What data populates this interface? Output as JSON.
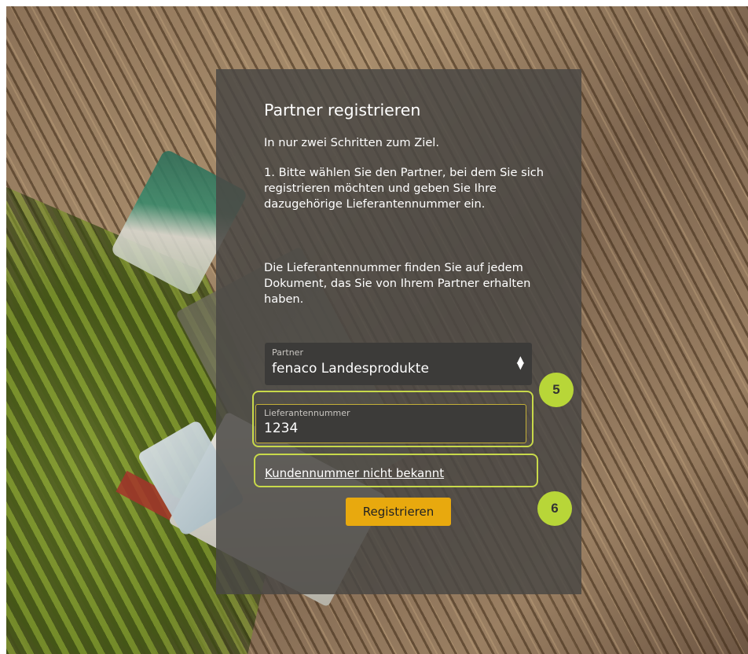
{
  "panel": {
    "title": "Partner registrieren",
    "subtitle": "In nur zwei Schritten zum Ziel.",
    "step1": "1. Bitte wählen Sie den Partner, bei dem Sie sich registrieren möchten und geben Sie Ihre dazugehörige Lieferantennummer ein.",
    "hint": "Die Lieferantennummer finden Sie auf jedem Dokument, das Sie von Ihrem Partner erhalten haben."
  },
  "partner_select": {
    "label": "Partner",
    "value": "fenaco Landesprodukte",
    "icon": "sort-arrows-icon"
  },
  "supplier_input": {
    "label": "Lieferantennummer",
    "value": "1234"
  },
  "link_unknown": "Kundennummer nicht bekannt",
  "register_button": "Registrieren",
  "callouts": {
    "five": "5",
    "six": "6"
  },
  "colors": {
    "accent_button": "#e8a90e",
    "highlight": "#c8d94a",
    "badge": "#b8d638",
    "panel": "#4a4845"
  }
}
